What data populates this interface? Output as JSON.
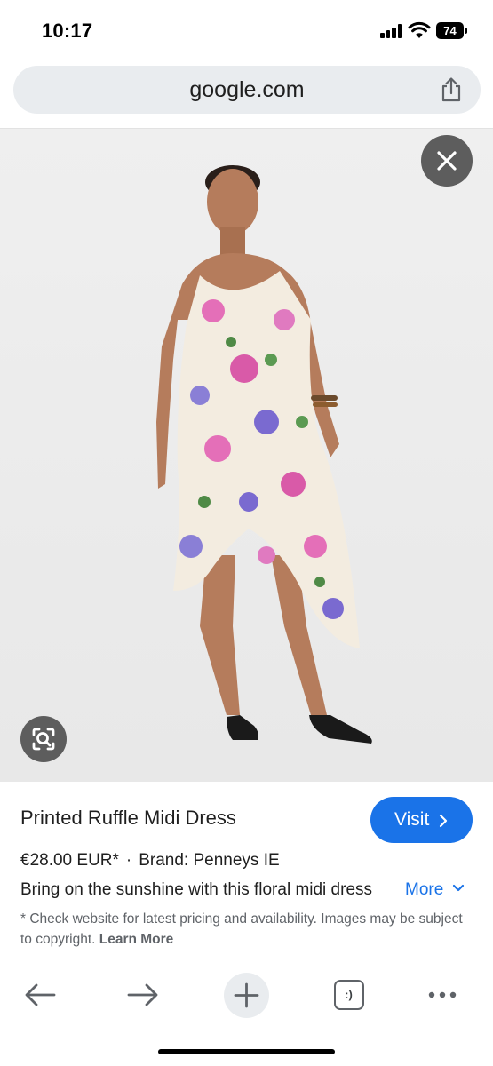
{
  "status_bar": {
    "time": "10:17",
    "battery": "74"
  },
  "browser": {
    "url": "google.com"
  },
  "image": {
    "description_icon": "product-photo-floral-dress"
  },
  "product": {
    "title": "Printed Ruffle Midi Dress",
    "visit_label": "Visit",
    "price": "€28.00 EUR*",
    "separator": "·",
    "brand": "Brand: Penneys IE",
    "description": "Bring on the sunshine with this floral midi dress",
    "more_label": "More",
    "disclaimer": "* Check website for latest pricing and availability. Images may be subject to copyright.",
    "learn_more": "Learn More"
  },
  "toolbar": {
    "tabs_label": ":)"
  },
  "colors": {
    "accent": "#1a73e8",
    "url_bar_bg": "#e9ecef",
    "overlay_button": "#5d5d5d"
  }
}
